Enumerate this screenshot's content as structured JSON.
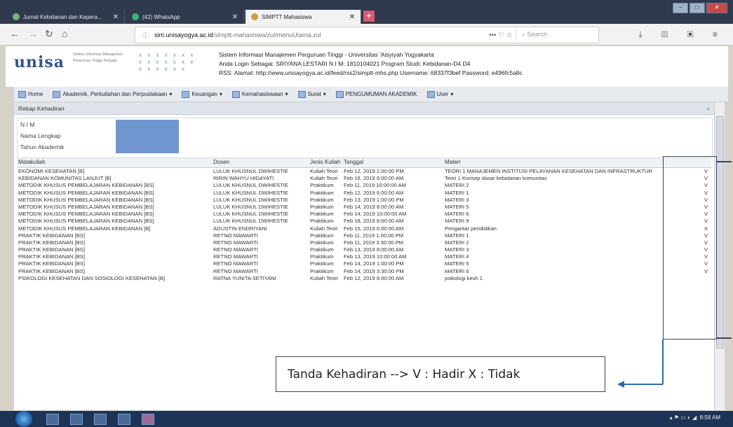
{
  "browser": {
    "tabs": [
      {
        "label": "Jurnal Kebidanan dan Kepera...",
        "active": false
      },
      {
        "label": "(42) WhatsApp",
        "active": false
      },
      {
        "label": "SIMPTT Mahasiswa",
        "active": true
      }
    ],
    "url_domain": "sim.unisayogya.ac.id",
    "url_path": "/simptt-mahasiswa/zul/menuUtama.zul",
    "search_placeholder": "Search"
  },
  "app": {
    "logo": "unisa",
    "tagline_1": "Sistem Informasi Manajemen",
    "tagline_2": "Perguruan Tinggi Terpadu",
    "title_line": "Sistem Informasi Manajemen Perguruan Tinggi - Universitas 'Aisyiyah Yogyakarta",
    "login_line": "Anda Login Sebagai: SRIYANA LESTARI   N I M: 1810104021   Program Studi: Kebidanan-D4 D4",
    "rss_line": "RSS:   Alamat: http://www.unisayogya.ac.id/feed/rss2/simptt-mhs.php   Username: 68337f3bef   Password: e496fc5a8c"
  },
  "menu": [
    "Home",
    "Akademik, Perkuliahan dan Perpustakaan",
    "Keuangan",
    "Kemahasiswaan",
    "Surat",
    "PENGUMUMAN AKADEMIK",
    "User"
  ],
  "panel_title": "Rekap Kehadiran",
  "form": {
    "nim_label": "N I M",
    "name_label": "Nama Lengkap",
    "year_label": "Tahun Akademik"
  },
  "table": {
    "headers": [
      "Matakuliah",
      "Dosen",
      "Jenis Kuliah",
      "Tanggal",
      "Materi",
      ""
    ],
    "rows": [
      [
        "EKONOMI KESEHATAN [B]",
        "LULUK KHUSNUL DWIHESTIE",
        "Kuliah Teori",
        "Feb 12, 2019 1:00:00 PM",
        "TEORI 1 MANAJEMEN INSTITUSI PELAYANAN KESEHATAN DAN INFRASTRUKTUR",
        "V"
      ],
      [
        "KEBIDANAN KOMUNITAS LANJUT [B]",
        "RIRIN WAHYU HIDAYATI",
        "Kuliah Teori",
        "Feb 16, 2019 6:00:00 AM",
        "Teori 1 Konsep dasar kebidanan komunitas",
        "V"
      ],
      [
        "METODIK KHUSUS PEMBELAJARAN KEBIDANAN [BS]",
        "LULUK KHUSNUL DWIHESTIE",
        "Praktikum",
        "Feb 11, 2019 10:00:00 AM",
        "MATERI 2",
        "V"
      ],
      [
        "METODIK KHUSUS PEMBELAJARAN KEBIDANAN [BS]",
        "LULUK KHUSNUL DWIHESTIE",
        "Praktikum",
        "Feb 12, 2019 6:00:00 AM",
        "MATERI 1",
        "V"
      ],
      [
        "METODIK KHUSUS PEMBELAJARAN KEBIDANAN [BS]",
        "LULUK KHUSNUL DWIHESTIE",
        "Praktikum",
        "Feb 13, 2019 1:00:00 PM",
        "MATERI 3",
        "V"
      ],
      [
        "METODIK KHUSUS PEMBELAJARAN KEBIDANAN [BS]",
        "LULUK KHUSNUL DWIHESTIE",
        "Praktikum",
        "Feb 14, 2019 8:00:00 AM",
        "MATERI 5",
        "V"
      ],
      [
        "METODIK KHUSUS PEMBELAJARAN KEBIDANAN [BS]",
        "LULUK KHUSNUL DWIHESTIE",
        "Praktikum",
        "Feb 14, 2019 10:00:00 AM",
        "MATERI 6",
        "V"
      ],
      [
        "METODIK KHUSUS PEMBELAJARAN KEBIDANAN [BS]",
        "LULUK KHUSNUL DWIHESTIE",
        "Praktikum",
        "Feb 18, 2019 8:00:00 AM",
        "MATERI 9",
        "V"
      ],
      [
        "METODIK KHUSUS PEMBELAJARAN KEBIDANAN [B]",
        "AGUSTIN ENDRIYANI",
        "Kuliah Teori",
        "Feb 15, 2019 6:00:00 AM",
        "Pengantar pendidikan",
        "X"
      ],
      [
        "PRAKTIK KEBIDANAN [BS]",
        "RETNO MAWARTI",
        "Praktikum",
        "Feb 11, 2019 1:00:00 PM",
        "MATERI 1",
        "V"
      ],
      [
        "PRAKTIK KEBIDANAN [BS]",
        "RETNO MAWARTI",
        "Praktikum",
        "Feb 11, 2019 3:30:00 PM",
        "MATERI 2",
        "V"
      ],
      [
        "PRAKTIK KEBIDANAN [BS]",
        "RETNO MAWARTI",
        "Praktikum",
        "Feb 13, 2019 8:00:00 AM",
        "MATERI 3",
        "V"
      ],
      [
        "PRAKTIK KEBIDANAN [BS]",
        "RETNO MAWARTI",
        "Praktikum",
        "Feb 13, 2019 10:00:00 AM",
        "MATERI 4",
        "V"
      ],
      [
        "PRAKTIK KEBIDANAN [BS]",
        "RETNO MAWARTI",
        "Praktikum",
        "Feb 14, 2019 1:00:00 PM",
        "MATERI 5",
        "V"
      ],
      [
        "PRAKTIK KEBIDANAN [BS]",
        "RETNO MAWARTI",
        "Praktikum",
        "Feb 14, 2019 3:30:00 PM",
        "MATERI 6",
        "V"
      ],
      [
        "PSIKOLOGI KESEHATAN DAN SOSIOLOGI KESEHATAN [B]",
        "RATNA YUNITA SETIYANI",
        "Kuliah Teori",
        "Feb 12, 2019 8:00:00 AM",
        "psikologi kesh 1",
        ""
      ]
    ]
  },
  "annotation": {
    "legend_text": "Tanda Kehadiran --> V : Hadir     X : Tidak"
  },
  "taskbar": {
    "clock": "8:58 AM"
  }
}
